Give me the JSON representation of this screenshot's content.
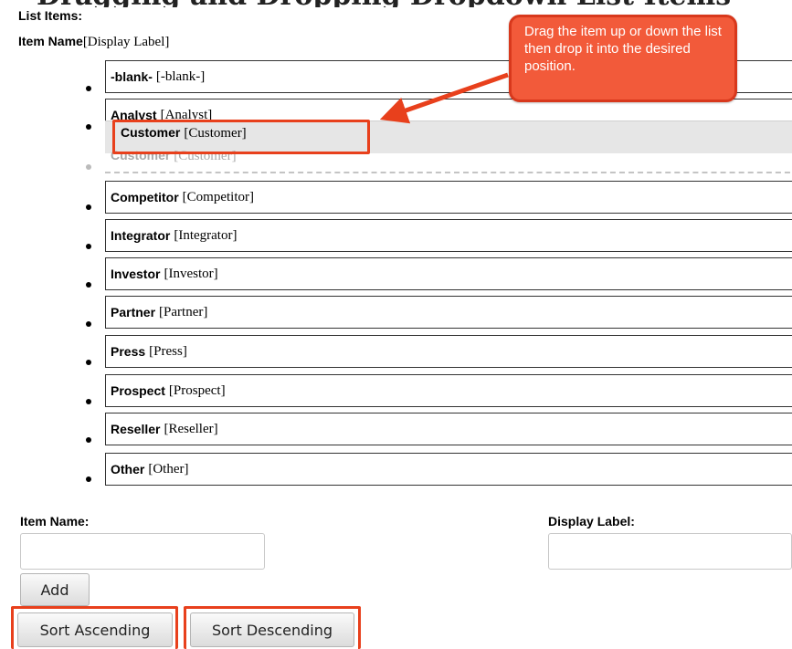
{
  "page": {
    "banner_text": "Dragging and Dropping Dropdown List Items",
    "list_heading": "List Items:",
    "column_header_name": "Item Name",
    "column_header_label": "[Display Label]"
  },
  "callout": {
    "text": "Drag the item up or down the list then drop it into the desired position."
  },
  "list_items": [
    {
      "name": "-blank-",
      "label": "[-blank-]"
    },
    {
      "name": "Analyst",
      "label": "[Analyst]"
    },
    {
      "name": "Competitor",
      "label": "[Competitor]"
    },
    {
      "name": "Integrator",
      "label": "[Integrator]"
    },
    {
      "name": "Investor",
      "label": "[Investor]"
    },
    {
      "name": "Partner",
      "label": "[Partner]"
    },
    {
      "name": "Press",
      "label": "[Press]"
    },
    {
      "name": "Prospect",
      "label": "[Prospect]"
    },
    {
      "name": "Reseller",
      "label": "[Reseller]"
    },
    {
      "name": "Other",
      "label": "[Other]"
    }
  ],
  "dragging_item": {
    "name": "Customer",
    "label": "[Customer]"
  },
  "ghost_item": {
    "name": "Customer",
    "label": "[Customer]"
  },
  "form": {
    "item_name_label": "Item Name:",
    "item_name_value": "",
    "display_label_label": "Display Label:",
    "display_label_value": ""
  },
  "buttons": {
    "add": "Add",
    "sort_ascending": "Sort Ascending",
    "sort_descending": "Sort Descending"
  },
  "colors": {
    "highlight": "#e8401c",
    "callout_fill": "#f25a3a"
  }
}
